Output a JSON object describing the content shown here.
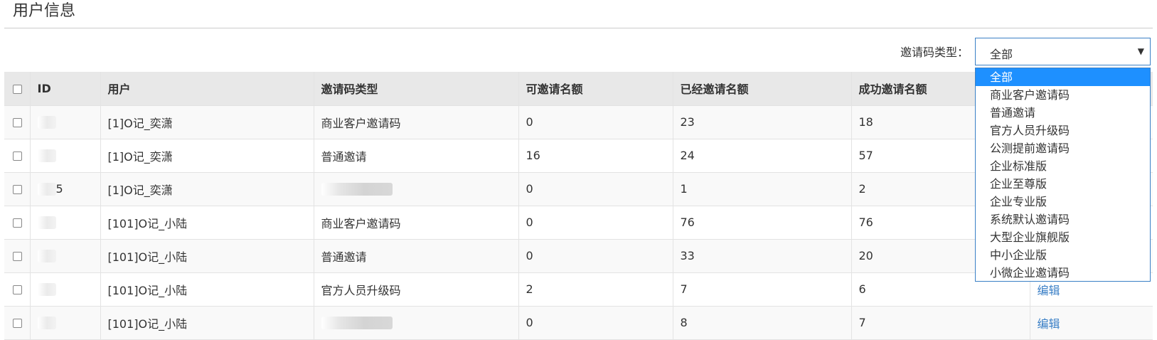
{
  "page": {
    "title": "用户信息"
  },
  "filter": {
    "label": "邀请码类型：",
    "selected": "全部",
    "caret": "▼",
    "options": [
      "全部",
      "商业客户邀请码",
      "普通邀请",
      "官方人员升级码",
      "公测提前邀请码",
      "企业标准版",
      "企业至尊版",
      "企业专业版",
      "系统默认邀请码",
      "大型企业旗舰版",
      "中小企业版",
      "小微企业邀请码"
    ]
  },
  "table": {
    "headers": [
      "ID",
      "用户",
      "邀请码类型",
      "可邀请名额",
      "已经邀请名额",
      "成功邀请名额",
      ""
    ],
    "rows": [
      {
        "id": "",
        "user": "[1]O记_奕潇",
        "type": "商业客户邀请码",
        "available": "0",
        "invited": "23",
        "success": "18",
        "action": ""
      },
      {
        "id": "",
        "user": "[1]O记_奕潇",
        "type": "普通邀请",
        "available": "16",
        "invited": "24",
        "success": "57",
        "action": ""
      },
      {
        "id": "5",
        "user": "[1]O记_奕潇",
        "type": "",
        "available": "0",
        "invited": "1",
        "success": "2",
        "action": ""
      },
      {
        "id": "",
        "user": "[101]O记_小陆",
        "type": "商业客户邀请码",
        "available": "0",
        "invited": "76",
        "success": "76",
        "action": ""
      },
      {
        "id": "",
        "user": "[101]O记_小陆",
        "type": "普通邀请",
        "available": "0",
        "invited": "33",
        "success": "20",
        "action": ""
      },
      {
        "id": "",
        "user": "[101]O记_小陆",
        "type": "官方人员升级码",
        "available": "2",
        "invited": "7",
        "success": "6",
        "action": "编辑"
      },
      {
        "id": "",
        "user": "[101]O记_小陆",
        "type": "",
        "available": "0",
        "invited": "8",
        "success": "7",
        "action": "编辑"
      }
    ]
  }
}
